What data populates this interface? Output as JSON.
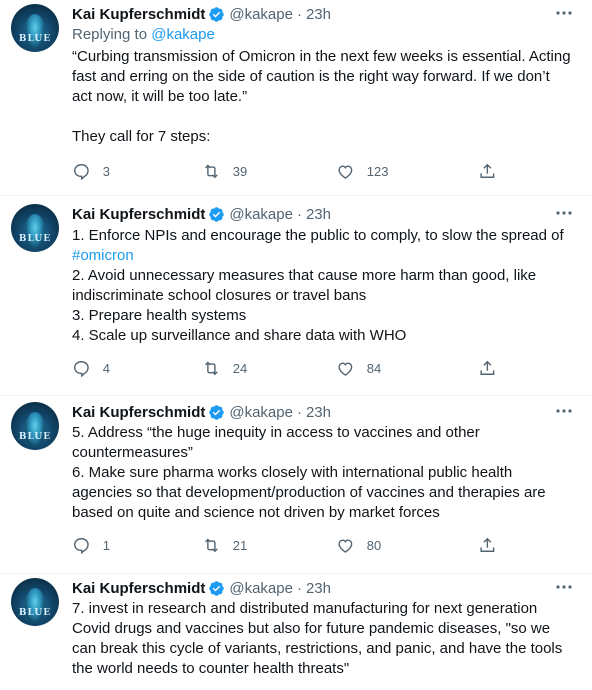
{
  "tweets": [
    {
      "author": {
        "name": "Kai Kupferschmidt",
        "handle": "@kakape",
        "avatar_text": "BLUE"
      },
      "time": "23h",
      "replying_prefix": "Replying to",
      "replying_to": "@kakape",
      "lines": [
        "“Curbing transmission of Omicron in the next few weeks is essential. Acting",
        "fast and erring on the side of caution is the right way forward. If we don’t",
        "act now, it will be too late.”",
        "",
        "They call for 7 steps:"
      ],
      "replies": "3",
      "retweets": "39",
      "likes": "123"
    },
    {
      "author": {
        "name": "Kai Kupferschmidt",
        "handle": "@kakape",
        "avatar_text": "BLUE"
      },
      "time": "23h",
      "line1": "1. Enforce NPIs and encourage the public to comply, to slow the spread of",
      "hashtag": "#omicron",
      "lines": [
        "2. Avoid unnecessary measures that cause more harm than good, like",
        "indiscriminate school closures or travel bans",
        "3. Prepare health systems",
        "4. Scale up surveillance and share data with WHO"
      ],
      "replies": "4",
      "retweets": "24",
      "likes": "84"
    },
    {
      "author": {
        "name": "Kai Kupferschmidt",
        "handle": "@kakape",
        "avatar_text": "BLUE"
      },
      "time": "23h",
      "lines": [
        "5. Address “the huge inequity in access to vaccines and other",
        "countermeasures”",
        "6. Make sure pharma works closely with international public health",
        "agencies so that development/production of vaccines and therapies are",
        "based on quite and science not driven by market forces"
      ],
      "replies": "1",
      "retweets": "21",
      "likes": "80"
    },
    {
      "author": {
        "name": "Kai Kupferschmidt",
        "handle": "@kakape",
        "avatar_text": "BLUE"
      },
      "time": "23h",
      "lines": [
        "7. invest in research and distributed manufacturing for next generation",
        "Covid drugs and vaccines but also for future pandemic diseases, \"so we",
        "can break this cycle of variants, restrictions, and panic, and have the tools",
        "the world needs to counter health threats\""
      ]
    }
  ],
  "icons": {
    "verified": "verified-badge-icon",
    "more": "more-options-icon",
    "reply": "reply-icon",
    "retweet": "retweet-icon",
    "like": "like-icon",
    "share": "share-icon"
  },
  "colors": {
    "accent": "#1d9bf0",
    "muted": "#536471",
    "text": "#0f1419"
  }
}
